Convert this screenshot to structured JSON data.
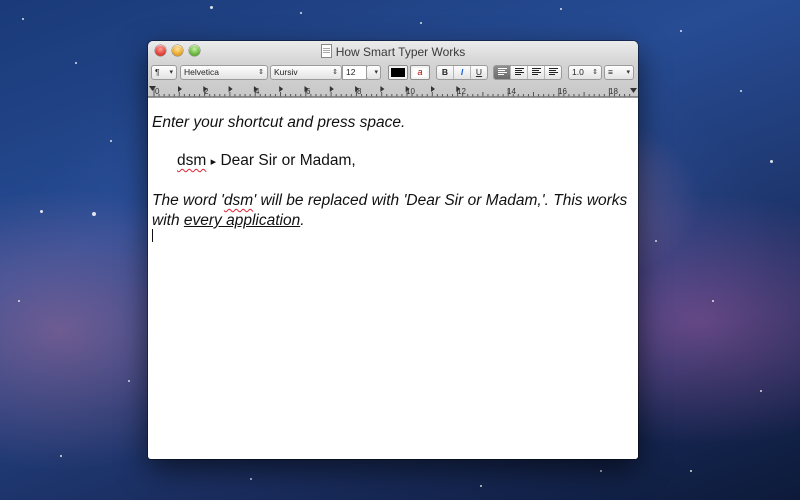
{
  "window": {
    "title": "How Smart Typer Works"
  },
  "toolbar": {
    "paragraph_style": "¶",
    "font_family": "Helvetica",
    "font_style": "Kursiv",
    "font_size": "12",
    "text_color": "#000000",
    "highlight_glyph": "a",
    "bold": "B",
    "italic": "I",
    "underline": "U",
    "line_spacing": "1.0",
    "list_style": "≡"
  },
  "ruler": {
    "labels": [
      "0",
      "2",
      "4",
      "6",
      "8",
      "10",
      "12",
      "14",
      "16",
      "18"
    ]
  },
  "document": {
    "line1": "Enter your shortcut and press space.",
    "shortcut": "dsm",
    "arrow": "▸",
    "expansion": "Dear Sir or Madam,",
    "p2_a": "The word '",
    "p2_word": "dsm",
    "p2_b": "' will be replaced with 'Dear Sir or Madam,'. This works with ",
    "p2_link": "every application",
    "p2_end": "."
  },
  "colors": {
    "spellcheck": "#dd2233",
    "selected_segment": "#6b6b6b"
  }
}
